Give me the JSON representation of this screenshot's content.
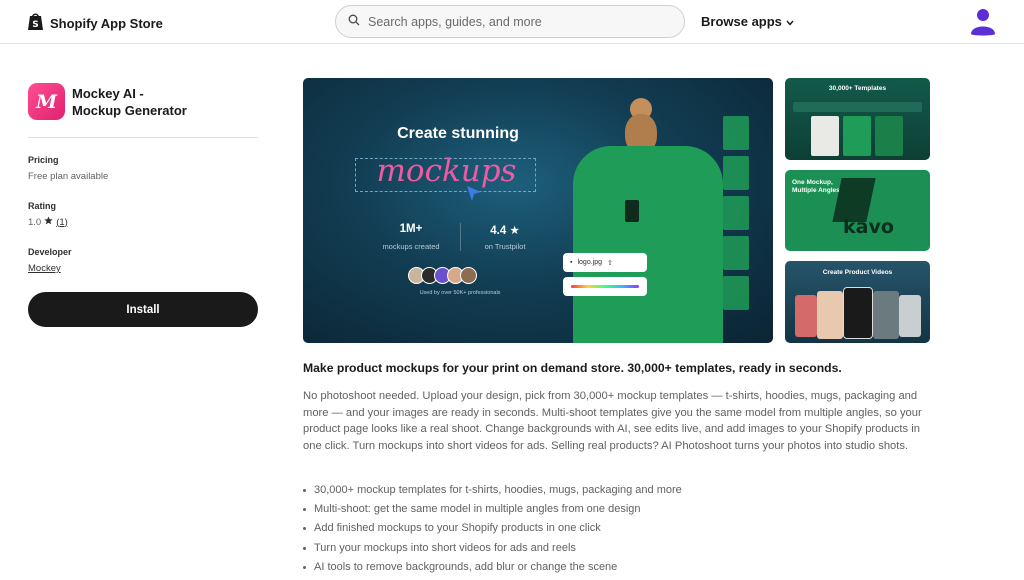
{
  "header": {
    "brand": "Shopify App Store",
    "search_placeholder": "Search apps, guides, and more",
    "browse_label": "Browse apps",
    "icons": [
      "shopify-bag-icon",
      "search-icon",
      "chevron-down-icon",
      "user-icon"
    ]
  },
  "app": {
    "icon_glyph": "M",
    "name_line1": "Mockey AI -",
    "name_line2": "Mockup Generator"
  },
  "sidebar": {
    "pricing_label": "Pricing",
    "pricing_value": "Free plan available",
    "rating_label": "Rating",
    "rating_value": "1.0",
    "rating_count": "(1)",
    "developer_label": "Developer",
    "developer_value": "Mockey",
    "install_label": "Install"
  },
  "hero": {
    "title": "Create stunning",
    "highlight": "mockups",
    "stat1_value": "1M+",
    "stat1_label": "mockups created",
    "stat2_value": "4.4",
    "stat2_label": "on Trustpilot",
    "used_by": "Used by over 50K+ professionals",
    "file_chip": "logo.jpg"
  },
  "thumbs": {
    "t1": "30,000+ Templates",
    "t2_line1": "One Mockup,",
    "t2_line2": "Multiple Angles",
    "t2_brand": "kavo",
    "t3": "Create Product Videos"
  },
  "content": {
    "headline": "Make product mockups for your print on demand store. 30,000+ templates, ready in seconds.",
    "description": "No photoshoot needed. Upload your design, pick from 30,000+ mockup templates — t-shirts, hoodies, mugs, packaging and more — and your images are ready in seconds. Multi-shoot templates give you the same model from multiple angles, so your product page looks like a real shoot. Change backgrounds with AI, see edits live, and add images to your Shopify products in one click. Turn mockups into short videos for ads. Selling real products? AI Photoshoot turns your photos into studio shots.",
    "features": [
      "30,000+ mockup templates for t-shirts, hoodies, mugs, packaging and more",
      "Multi-shoot: get the same model in multiple angles from one design",
      "Add finished mockups to your Shopify products in one click",
      "Turn your mockups into short videos for ads and reels",
      "AI tools to remove backgrounds, add blur or change the scene"
    ]
  },
  "colors": {
    "brand_green": "#1f9c57",
    "app_pink": "#e0206e",
    "user_purple": "#5c2ed6",
    "install_bg": "#1a1a1a"
  }
}
